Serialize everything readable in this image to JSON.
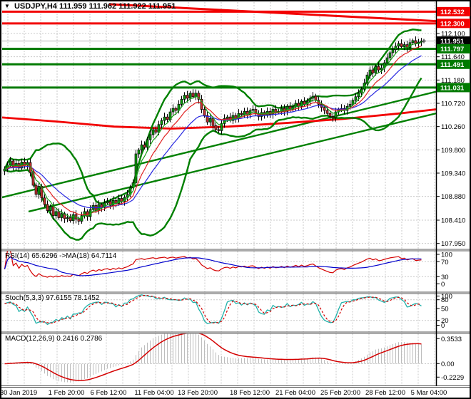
{
  "window": {
    "title_symbol": "USDJPY,H4",
    "title_ohlc": "111.959 111.962 111.922 111.951"
  },
  "colors": {
    "bull": "#0ba00b",
    "bear": "#c83232",
    "wick": "#000000",
    "band_green": "#008000",
    "level_green": "#007a00",
    "level_red": "#f20000",
    "ma_fast": "#18a018",
    "ma_mid": "#e02020",
    "ma_slow": "#2828e0",
    "rsi_line": "#d40000",
    "rsi_ma": "#0000cd",
    "stoch_k": "#20b2aa",
    "stoch_d": "#d40000",
    "macd_hist": "#bdbdbd",
    "macd_signal": "#d40000",
    "grid": "#c9c9c9",
    "current_price_line": "#b4b4b4",
    "badge_black": "#000000",
    "badge_text": "#ffffff",
    "axis_text": "#000000"
  },
  "price_axis": {
    "ticks": [
      {
        "t": "112.100",
        "p": 112.1
      },
      {
        "t": "111.640",
        "p": 111.64
      },
      {
        "t": "111.180",
        "p": 111.18
      },
      {
        "t": "110.720",
        "p": 110.72
      },
      {
        "t": "110.260",
        "p": 110.26
      },
      {
        "t": "109.800",
        "p": 109.8
      },
      {
        "t": "109.340",
        "p": 109.34
      },
      {
        "t": "108.880",
        "p": 108.88
      },
      {
        "t": "108.410",
        "p": 108.41
      },
      {
        "t": "107.950",
        "p": 107.95
      }
    ],
    "badges": [
      {
        "t": "112.532",
        "p": 112.532,
        "bg": "#f20000"
      },
      {
        "t": "112.300",
        "p": 112.3,
        "bg": "#f20000"
      },
      {
        "t": "111.951",
        "p": 111.951,
        "bg": "#000000"
      },
      {
        "t": "111.797",
        "p": 111.797,
        "bg": "#007a00"
      },
      {
        "t": "111.491",
        "p": 111.491,
        "bg": "#007a00"
      },
      {
        "t": "111.031",
        "p": 111.031,
        "bg": "#007a00"
      }
    ]
  },
  "time_axis": {
    "labels": [
      {
        "t": "30 Jan 2019",
        "x": 26
      },
      {
        "t": "1 Feb 20:00",
        "x": 93
      },
      {
        "t": "6 Feb 12:00",
        "x": 152
      },
      {
        "t": "11 Feb 04:00",
        "x": 216
      },
      {
        "t": "13 Feb 20:00",
        "x": 277
      },
      {
        "t": "18 Feb 12:00",
        "x": 350
      },
      {
        "t": "21 Feb 04:00",
        "x": 414
      },
      {
        "t": "25 Feb 20:00",
        "x": 477
      },
      {
        "t": "28 Feb 12:00",
        "x": 540
      },
      {
        "t": "5 Mar 04:00",
        "x": 601
      }
    ]
  },
  "panels": {
    "rsi": {
      "label": "RSI(14) 65.6296  ->MA(18) 64.7114",
      "ticks": [
        "100",
        "70",
        "30",
        "0"
      ]
    },
    "stoch": {
      "label": "Stoch(5,3,3) 97.6155 78.1452",
      "ticks": [
        "100",
        "80",
        "50",
        "20",
        "0"
      ]
    },
    "macd": {
      "label": "MACD(12,26,9) 0.2416 0.2786",
      "ticks": [
        "0.3533",
        "0.00",
        "-0.2229"
      ]
    }
  },
  "chart_data": {
    "type": "candlestick",
    "symbol": "USDJPY",
    "timeframe": "H4",
    "title": "USDJPY,H4 111.959 111.962 111.922 111.951",
    "ylim": [
      107.89,
      112.72
    ],
    "grid": true,
    "legend_position": "top-left-of-each-panel",
    "last_price": 111.951,
    "first_open": 109.38,
    "closes": [
      109.42,
      109.5,
      109.58,
      109.47,
      109.53,
      109.44,
      109.56,
      109.5,
      109.55,
      109.35,
      109.1,
      108.92,
      109.08,
      108.85,
      108.72,
      108.6,
      108.68,
      108.5,
      108.58,
      108.46,
      108.54,
      108.44,
      108.46,
      108.4,
      108.52,
      108.43,
      108.39,
      108.5,
      108.58,
      108.48,
      108.62,
      108.7,
      108.6,
      108.72,
      108.66,
      108.75,
      108.78,
      108.7,
      108.8,
      108.74,
      108.84,
      108.78,
      108.86,
      108.92,
      109.05,
      109.15,
      109.72,
      109.8,
      109.9,
      109.85,
      110.0,
      110.1,
      110.2,
      110.15,
      110.3,
      110.38,
      110.45,
      110.4,
      110.55,
      110.62,
      110.58,
      110.7,
      110.8,
      110.88,
      110.82,
      110.92,
      110.85,
      110.92,
      110.8,
      110.6,
      110.48,
      110.35,
      110.42,
      110.28,
      110.2,
      110.18,
      110.32,
      110.42,
      110.45,
      110.38,
      110.48,
      110.42,
      110.52,
      110.5,
      110.56,
      110.5,
      110.58,
      110.6,
      110.52,
      110.46,
      110.54,
      110.48,
      110.56,
      110.5,
      110.6,
      110.54,
      110.56,
      110.62,
      110.56,
      110.66,
      110.6,
      110.65,
      110.72,
      110.66,
      110.76,
      110.7,
      110.75,
      110.82,
      110.86,
      110.78,
      110.7,
      110.64,
      110.58,
      110.52,
      110.46,
      110.44,
      110.55,
      110.6,
      110.62,
      110.58,
      110.66,
      110.7,
      110.78,
      110.85,
      110.92,
      111.0,
      111.12,
      111.28,
      111.38,
      111.32,
      111.45,
      111.38,
      111.42,
      111.52,
      111.62,
      111.72,
      111.78,
      111.85,
      111.9,
      111.84,
      111.88,
      111.82,
      111.92,
      111.96,
      111.9,
      111.93,
      111.951
    ],
    "levels": {
      "resistance_red": [
        112.532,
        112.3
      ],
      "support_green": [
        111.797,
        111.491,
        111.031
      ]
    },
    "trendlines": [
      {
        "name": "descending-resistance",
        "x1": 153,
        "p1": 112.68,
        "x2": 611,
        "p2": 112.345,
        "color": "#f20000",
        "w": 3
      },
      {
        "name": "rising-support-1",
        "x1": 0,
        "p1": 108.85,
        "x2": 611,
        "p2": 110.95,
        "color": "#008000",
        "w": 2.4
      },
      {
        "name": "rising-support-2",
        "x1": 40,
        "p1": 108.58,
        "x2": 611,
        "p2": 110.52,
        "color": "#008000",
        "w": 2.4
      }
    ],
    "red_ma_waypoints": [
      [
        3,
        110.44
      ],
      [
        80,
        110.36
      ],
      [
        160,
        110.26
      ],
      [
        240,
        110.22
      ],
      [
        320,
        110.26
      ],
      [
        400,
        110.33
      ],
      [
        480,
        110.41
      ],
      [
        560,
        110.52
      ],
      [
        611,
        110.6
      ]
    ],
    "indicators": {
      "bollinger": {
        "period": 20,
        "deviation": 2
      },
      "ma_periods": {
        "fast": 5,
        "mid": 10,
        "slow": 20
      },
      "rsi": {
        "period": 14,
        "ma": 18,
        "value": 65.6296,
        "ma_value": 64.7114,
        "levels": [
          70,
          30
        ]
      },
      "stoch": {
        "k": 5,
        "d": 3,
        "slowing": 3,
        "value": 97.6155,
        "signal": 78.1452,
        "levels": [
          80,
          20
        ]
      },
      "macd": {
        "fast": 12,
        "slow": 26,
        "signal": 9,
        "value": 0.2416,
        "signal_value": 0.2786,
        "scale_max": 0.3533,
        "scale_min": -0.2229
      }
    }
  }
}
